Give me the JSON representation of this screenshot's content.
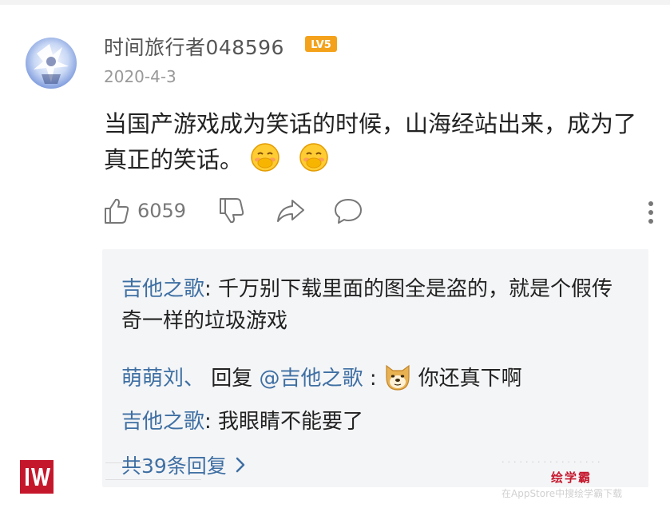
{
  "post": {
    "username": "时间旅行者048596",
    "level_badge": "LV5",
    "date": "2020-4-3",
    "comment_text": "当国产游戏成为笑话的时候，山海经站出来，成为了真正的笑话。",
    "emoji_icons": [
      "blushing-smile-icon",
      "blushing-smile-icon"
    ],
    "like_count": "6059"
  },
  "replies": {
    "items": [
      {
        "author": "吉他之歌",
        "separator": ": ",
        "text": "千万别下载里面的图全是盗的，就是个假传奇一样的垃圾游戏"
      },
      {
        "author": "萌萌刘、",
        "reply_word": " 回复 ",
        "mention": "@吉他之歌",
        "separator": " :",
        "emoji": "doge-icon",
        "text": "你还真下啊"
      },
      {
        "author": "吉他之歌",
        "separator": ": ",
        "text": "我眼睛不能要了"
      }
    ],
    "total_label": "共39条回复"
  },
  "watermark": {
    "right_line2": "绘学霸",
    "right_line3": "在AppStore中搜绘学霸下载"
  },
  "colors": {
    "link_blue": "#3e6fa3",
    "reply_bg": "#f4f5f7",
    "badge_orange": "#f4a21b",
    "logo_red": "#c5172c"
  }
}
